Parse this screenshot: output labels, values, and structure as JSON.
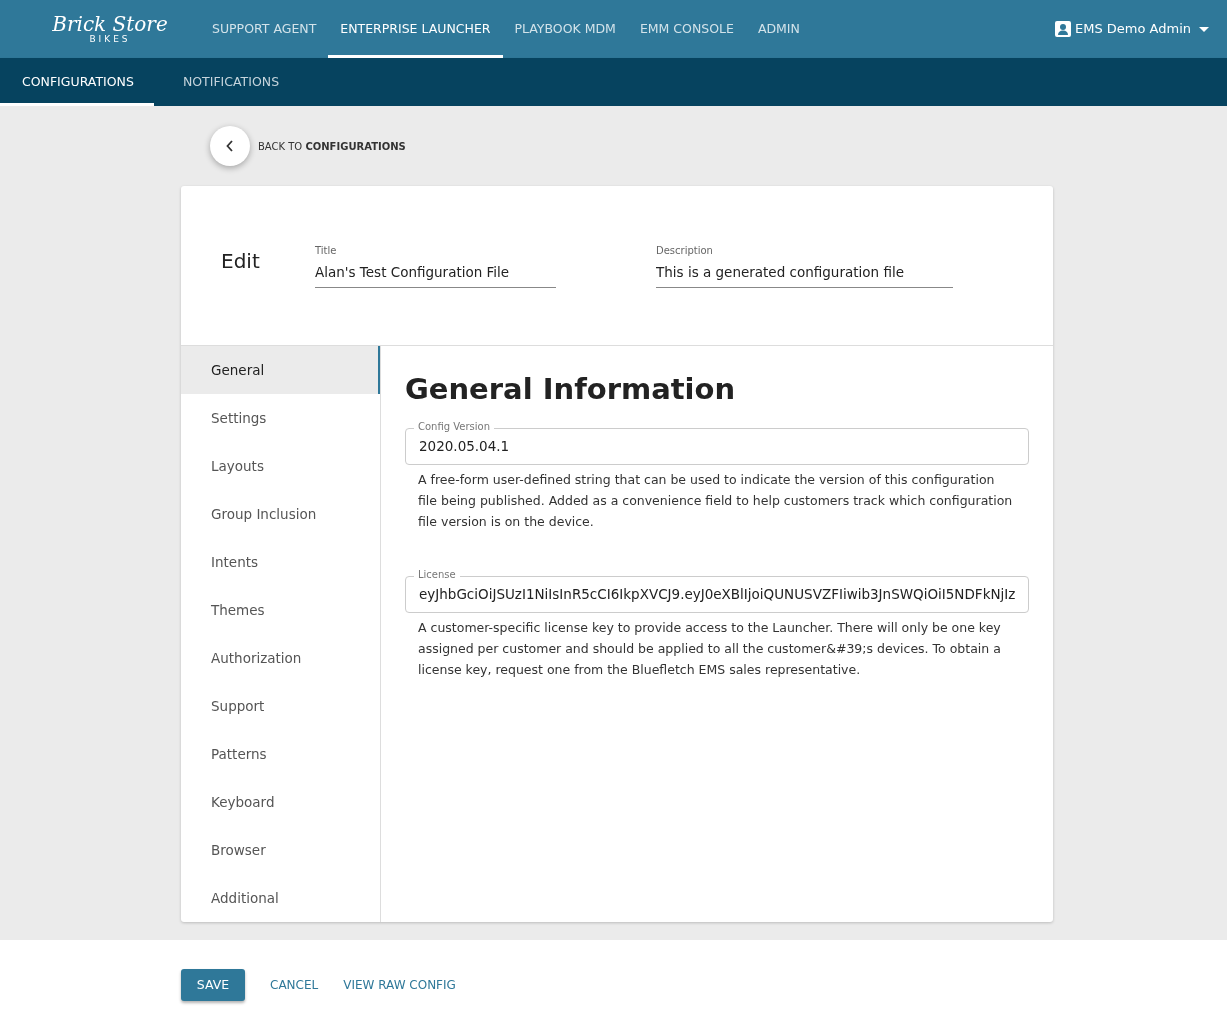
{
  "logo": {
    "name": "Brick Store",
    "tagline": "BIKES"
  },
  "top_nav": [
    {
      "label": "SUPPORT AGENT",
      "selected": false
    },
    {
      "label": "ENTERPRISE LAUNCHER",
      "selected": true
    },
    {
      "label": "PLAYBOOK MDM",
      "selected": false
    },
    {
      "label": "EMM CONSOLE",
      "selected": false
    },
    {
      "label": "ADMIN",
      "selected": false
    }
  ],
  "user_menu": {
    "label": "EMS Demo Admin"
  },
  "sub_nav": [
    {
      "label": "CONFIGURATIONS",
      "selected": true
    },
    {
      "label": "NOTIFICATIONS",
      "selected": false
    }
  ],
  "back_link": "BACK TO **CONFIGURATIONS**",
  "header": {
    "title": "Edit",
    "fields": [
      {
        "label": "Title",
        "value": "Alan's Test Configuration File"
      },
      {
        "label": "Description",
        "value": "This is a generated configuration file"
      }
    ]
  },
  "sidebar": {
    "items": [
      {
        "label": "General",
        "selected": true
      },
      {
        "label": "Settings",
        "selected": false
      },
      {
        "label": "Layouts",
        "selected": false
      },
      {
        "label": "Group Inclusion",
        "selected": false
      },
      {
        "label": "Intents",
        "selected": false
      },
      {
        "label": "Themes",
        "selected": false
      },
      {
        "label": "Authorization",
        "selected": false
      },
      {
        "label": "Support",
        "selected": false
      },
      {
        "label": "Patterns",
        "selected": false
      },
      {
        "label": "Keyboard",
        "selected": false
      },
      {
        "label": "Browser",
        "selected": false
      },
      {
        "label": "Additional",
        "selected": false
      }
    ]
  },
  "section": {
    "heading": "General Information",
    "fields": [
      {
        "label": "Config Version",
        "value": "2020.05.04.1",
        "help": "A free-form user-defined string that can be used to indicate the version of this configuration file being published. Added as a convenience field to help customers track which configuration file version is on the device."
      },
      {
        "label": "License",
        "value": "eyJhbGciOiJSUzI1NiIsInR5cCI6IkpXVCJ9.eyJ0eXBlIjoiQUNUSVZFIiwib3JnSWQiOiI5NDFkNjIz",
        "help": "A customer-specific license key to provide access to the Launcher. There will only be one key assigned per customer and should be applied to all the customer&#39;s devices. To obtain a license key, request one from the Bluefletch EMS sales representative."
      }
    ]
  },
  "actions": [
    {
      "label": "SAVE",
      "kind": "primary"
    },
    {
      "label": "CANCEL",
      "kind": "link"
    },
    {
      "label": "VIEW RAW CONFIG",
      "kind": "link"
    }
  ]
}
